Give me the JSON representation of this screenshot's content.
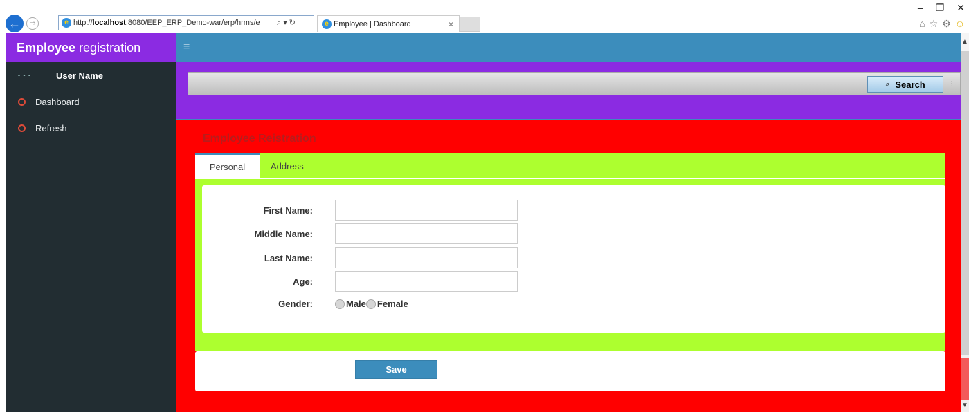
{
  "browser": {
    "url_prefix": "http://",
    "url_host": "localhost",
    "url_rest": ":8080/EEP_ERP_Demo-war/erp/hrms/e",
    "url_tools": "⌕ ▾ ↻",
    "tab_title": "Employee | Dashboard",
    "tab_close": "×",
    "window_controls": [
      "–",
      "❐",
      "✕"
    ],
    "toolbar_icons": [
      "home-icon",
      "star-icon",
      "gear-icon",
      "smiley-icon"
    ]
  },
  "sidebar": {
    "brand_bold": "Employee",
    "brand_rest": " registration",
    "user_name": "User Name",
    "items": [
      {
        "label": "Dashboard"
      },
      {
        "label": "Refresh"
      }
    ]
  },
  "topbar": {
    "menu_icon": "≡"
  },
  "search": {
    "label": "Search",
    "icon": "⌕"
  },
  "form": {
    "title": "Employee Reistration",
    "tabs": [
      {
        "label": "Personal"
      },
      {
        "label": "Address"
      }
    ],
    "fields": {
      "first_name": "First Name:",
      "middle_name": "Middle Name:",
      "last_name": "Last Name:",
      "age": "Age:",
      "gender": "Gender:"
    },
    "gender_options": [
      "Male",
      "Female"
    ],
    "save_label": "Save"
  },
  "colors": {
    "brand_purple": "#8b2be2",
    "topbar_blue": "#3c8dbc",
    "content_red": "#ff0000",
    "panel_green": "#adff2f",
    "sidebar_dark": "#222d32"
  }
}
